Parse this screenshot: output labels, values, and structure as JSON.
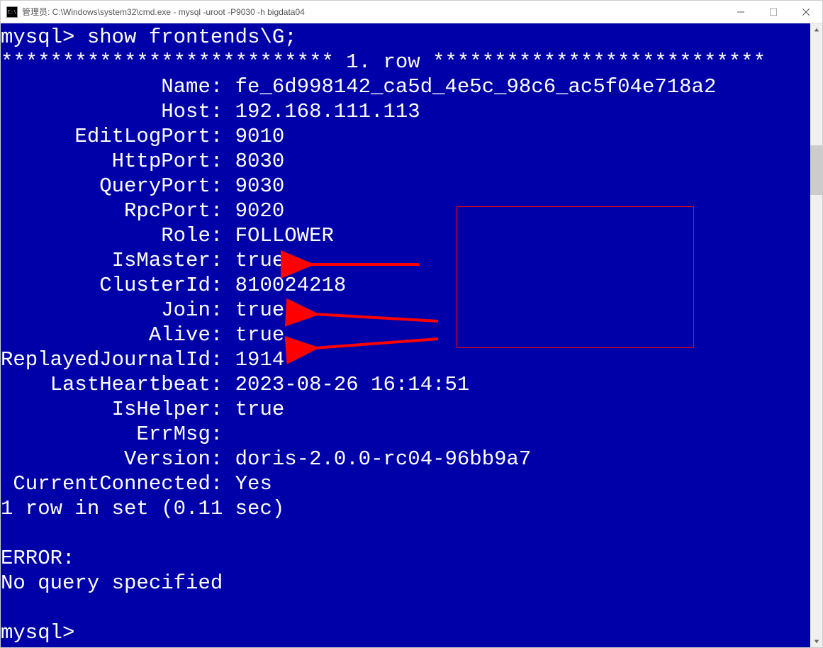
{
  "window": {
    "title": "管理员: C:\\Windows\\system32\\cmd.exe - mysql  -uroot -P9030 -h bigdata04",
    "icon_label": "C:\\"
  },
  "terminal": {
    "prompt1": "mysql> ",
    "command": "show frontends\\G;",
    "row_sep_left": "*************************** ",
    "row_label": "1. row ",
    "row_sep_right": "***************************",
    "fields": [
      {
        "label": "Name",
        "value": "fe_6d998142_ca5d_4e5c_98c6_ac5f04e718a2"
      },
      {
        "label": "Host",
        "value": "192.168.111.113"
      },
      {
        "label": "EditLogPort",
        "value": "9010"
      },
      {
        "label": "HttpPort",
        "value": "8030"
      },
      {
        "label": "QueryPort",
        "value": "9030"
      },
      {
        "label": "RpcPort",
        "value": "9020"
      },
      {
        "label": "Role",
        "value": "FOLLOWER"
      },
      {
        "label": "IsMaster",
        "value": "true"
      },
      {
        "label": "ClusterId",
        "value": "810024218"
      },
      {
        "label": "Join",
        "value": "true"
      },
      {
        "label": "Alive",
        "value": "true"
      },
      {
        "label": "ReplayedJournalId",
        "value": "1914"
      },
      {
        "label": "LastHeartbeat",
        "value": "2023-08-26 16:14:51"
      },
      {
        "label": "IsHelper",
        "value": "true"
      },
      {
        "label": "ErrMsg",
        "value": ""
      },
      {
        "label": "Version",
        "value": "doris-2.0.0-rc04-96bb9a7"
      },
      {
        "label": "CurrentConnected",
        "value": "Yes"
      }
    ],
    "footer1": "1 row in set (0.11 sec)",
    "blank": "",
    "error_label": "ERROR:",
    "error_msg": "No query specified",
    "prompt2": "mysql> "
  }
}
